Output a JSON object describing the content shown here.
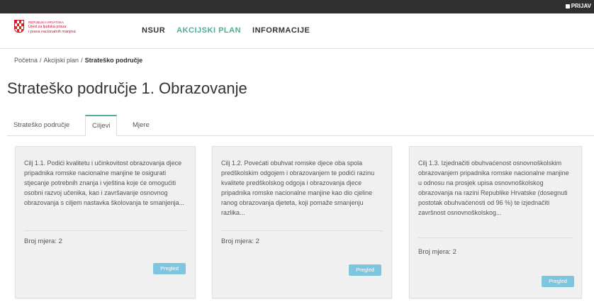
{
  "topbar": {
    "login_label": "PRIJAV"
  },
  "logo": {
    "line0": "REPUBLIKA HRVATSKA",
    "line1": "Ured za ljudska prava",
    "line2": "i prava nacionalnih manjina"
  },
  "nav": {
    "items": [
      "NSUR",
      "AKCIJSKI PLAN",
      "INFORMACIJE"
    ],
    "active": "AKCIJSKI PLAN"
  },
  "breadcrumb": {
    "items": [
      "Početna",
      "Akcijski plan",
      "Strateško područje"
    ],
    "separator": "/"
  },
  "page_title": "Strateško područje 1. Obrazovanje",
  "tabs": {
    "items": [
      "Strateško područje",
      "Ciljevi",
      "Mjere"
    ],
    "active": "Ciljevi"
  },
  "cards": [
    {
      "desc": "Cilj 1.1. Podići kvalitetu i učinkovitost obrazovanja djece pripadnika romske nacionalne manjine te osigurati stjecanje potrebnih znanja i vještina koje će omogućiti osobni razvoj učenika, kao i završavanje osnovnog obrazovanja s ciljem nastavka školovanja te smanjenja...",
      "count": "Broj mjera: 2",
      "button": "Pregled"
    },
    {
      "desc": "Cilj 1.2. Povećati obuhvat romske djece oba spola predškolskim odgojem i obrazovanjem te podići razinu kvalitete predškolskog odgoja i obrazovanja djece pripadnika romske nacionalne manjine kao dio cjeline ranog obrazovanja djeteta, koji pomaže smanjenju razlika...",
      "count": "Broj mjera: 2",
      "button": "Pregled"
    },
    {
      "desc": "Cilj 1.3. Izjednačiti obuhvaćenost osnovnoškolskim obrazovanjem pripadnika romske nacionalne manjine u odnosu na prosjek upisa osnovnoškolskog obrazovanja na razini Republike Hrvatske (dosegnuti postotak obuhvaćenosti od 96 %) te izjednačiti završnost osnovnoškolskog...",
      "count": "Broj mjera: 2",
      "button": "Pregled"
    }
  ],
  "colors": {
    "accent": "#4cae9a",
    "button": "#7ec6e0",
    "topbar": "#2f2f2f"
  }
}
